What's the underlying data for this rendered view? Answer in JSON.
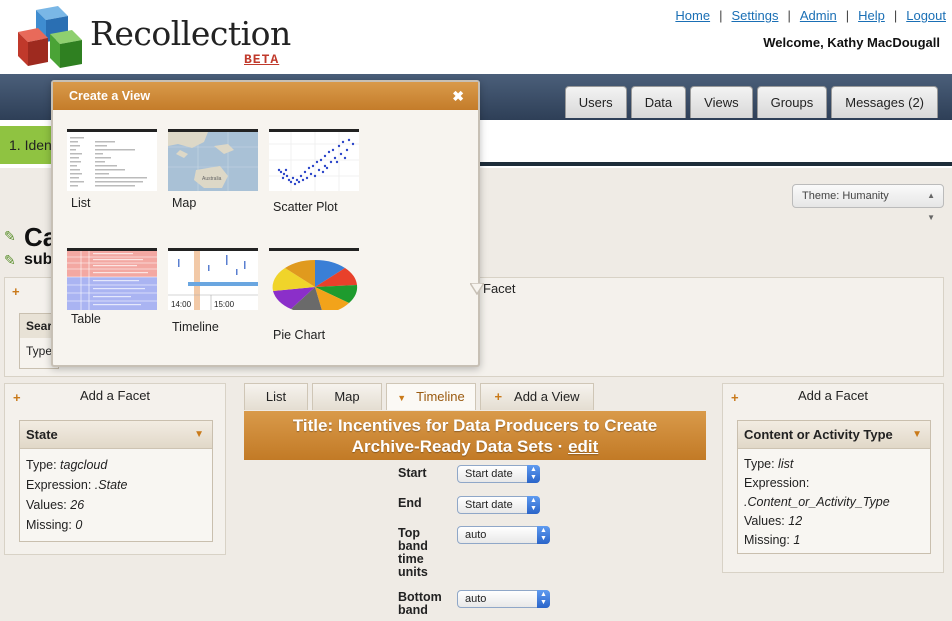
{
  "header": {
    "app_name": "Recollection",
    "beta": "BETA",
    "links": [
      "Home",
      "Settings",
      "Admin",
      "Help",
      "Logout"
    ],
    "welcome": "Welcome, Kathy MacDougall"
  },
  "nav": {
    "tabs": [
      "Users",
      "Data",
      "Views",
      "Groups",
      "Messages (2)"
    ]
  },
  "steps": {
    "step1": "1. Iden"
  },
  "theme": {
    "label": "Theme: Humanity"
  },
  "collection": {
    "title": "Ca",
    "subtitle": "sub"
  },
  "top_facet": {
    "add_label": "Facet",
    "partial_box_header": "Sear",
    "partial_box_line": "Type"
  },
  "popup": {
    "title": "Create a View",
    "close": "✖",
    "views": [
      {
        "label": "List",
        "icon": "list-thumbnail"
      },
      {
        "label": "Map",
        "icon": "map-thumbnail"
      },
      {
        "label": "Scatter Plot",
        "icon": "scatter-thumbnail"
      },
      {
        "label": "Table",
        "icon": "table-thumbnail"
      },
      {
        "label": "Timeline",
        "icon": "timeline-thumbnail"
      },
      {
        "label": "Pie Chart",
        "icon": "pie-thumbnail"
      }
    ],
    "timeline_ticks": [
      "14:00",
      "15:00"
    ]
  },
  "left_facet": {
    "add_label": "Add a Facet",
    "header": "State",
    "type_label": "Type: ",
    "type_value": "tagcloud",
    "expr_label": "Expression: ",
    "expr_value": ".State",
    "values_label": "Values: ",
    "values_value": "26",
    "missing_label": "Missing: ",
    "missing_value": "0"
  },
  "right_facet": {
    "add_label": "Add a Facet",
    "header": "Content or Activity Type",
    "type_label": "Type: ",
    "type_value": "list",
    "expr_label": "Expression:",
    "expr_value": ".Content_or_Activity_Type",
    "values_label": "Values: ",
    "values_value": "12",
    "missing_label": "Missing: ",
    "missing_value": "1"
  },
  "view_tabs": [
    "List",
    "Map",
    "Timeline",
    "Add a View"
  ],
  "banner": {
    "line1": "Title: Incentives for Data Producers to Create",
    "line2": "Archive-Ready Data Sets · ",
    "edit": "edit"
  },
  "settings": {
    "start_label": "Start",
    "start_value": "Start date",
    "end_label": "End",
    "end_value": "Start date",
    "top_band_label": [
      "Top",
      "band",
      "time",
      "units"
    ],
    "top_band_value": "auto",
    "bottom_band_label": [
      "Bottom",
      "band"
    ],
    "bottom_band_value": "auto"
  },
  "colors": {
    "accent": "#c97a1a",
    "nav": "#3b4d66",
    "link": "#1a6fb5",
    "step": "#8fc341"
  }
}
